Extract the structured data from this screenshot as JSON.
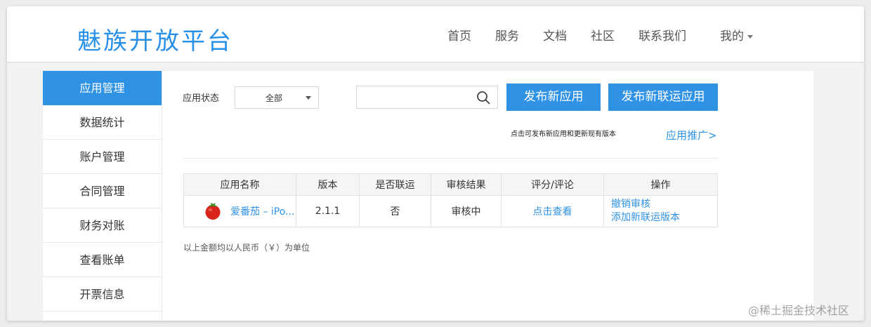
{
  "header": {
    "logo_text": "魅族开放平台",
    "nav": [
      {
        "label": "首页"
      },
      {
        "label": "服务"
      },
      {
        "label": "文档"
      },
      {
        "label": "社区"
      },
      {
        "label": "联系我们"
      },
      {
        "label": "我的"
      }
    ]
  },
  "sidebar": {
    "items": [
      {
        "label": "应用管理",
        "active": true
      },
      {
        "label": "数据统计"
      },
      {
        "label": "账户管理"
      },
      {
        "label": "合同管理"
      },
      {
        "label": "财务对账"
      },
      {
        "label": "查看账单"
      },
      {
        "label": "开票信息"
      }
    ]
  },
  "filter": {
    "status_label": "应用状态",
    "status_selected": "全部",
    "search_value": "",
    "search_placeholder": ""
  },
  "actions": {
    "new_app_label": "发布新应用",
    "new_joint_app_label": "发布新联运应用",
    "hint": "点击可发布新应用和更新现有版本",
    "promo_link": "应用推广>"
  },
  "table": {
    "headers": [
      "应用名称",
      "版本",
      "是否联运",
      "审核结果",
      "评分/评论",
      "操作"
    ],
    "rows": [
      {
        "app_name": "爱番茄 – iPo...",
        "icon": "tomato-icon",
        "version": "2.1.1",
        "joint_operation": "否",
        "review_result": "审核中",
        "rating_link": "点击查看",
        "ops": [
          "撤销审核",
          "添加新联运版本"
        ]
      }
    ]
  },
  "footnote": "以上金额均以人民币（￥）为单位",
  "watermark": "@稀土掘金技术社区",
  "colors": {
    "accent": "#2f92e4",
    "logo": "#2990e8",
    "review_pending": "#e8690b"
  }
}
